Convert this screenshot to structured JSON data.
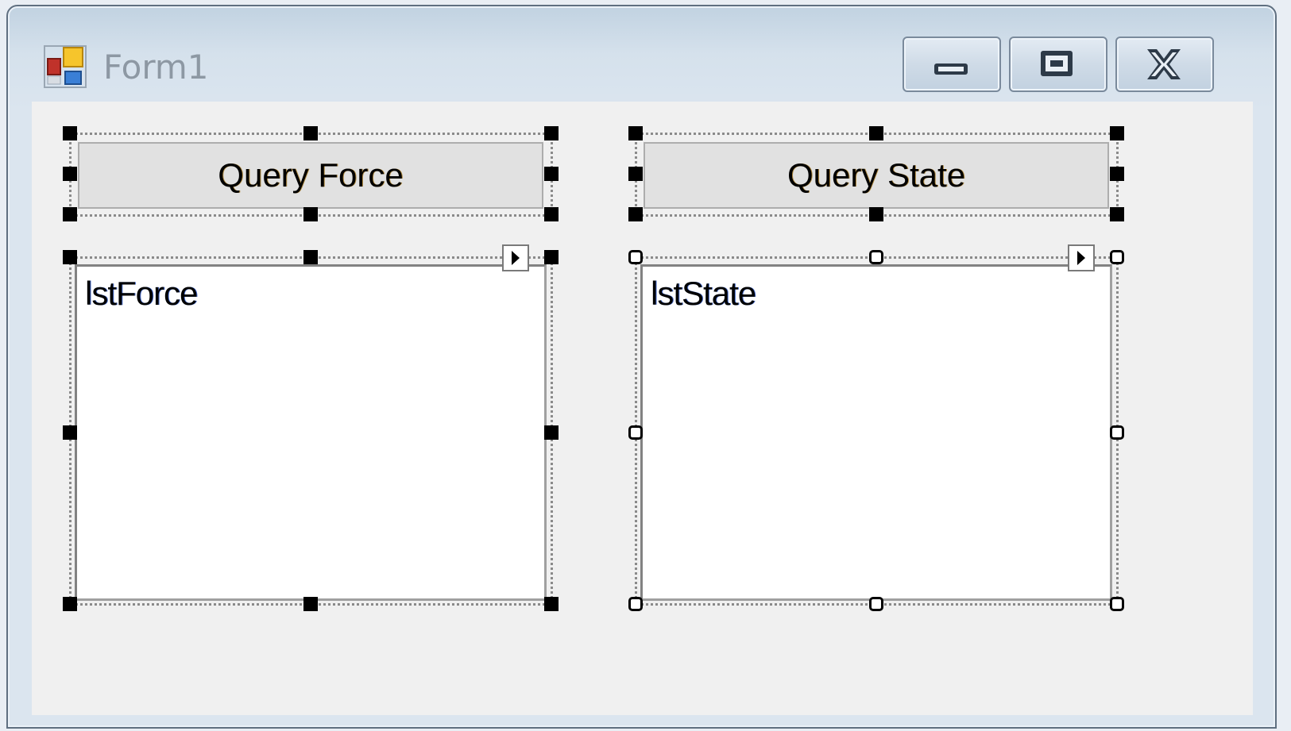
{
  "window": {
    "title": "Form1"
  },
  "caption_buttons": {
    "minimize_icon": "minimize-icon",
    "restore_icon": "restore-icon",
    "close_icon": "close-icon"
  },
  "controls": {
    "query_force_button": {
      "label": "Query Force"
    },
    "query_state_button": {
      "label": "Query State"
    },
    "force_listbox": {
      "name": "lstForce"
    },
    "state_listbox": {
      "name": "lstState"
    }
  },
  "colors": {
    "client_background": "#f0f0f0",
    "button_face": "#e1e1e1",
    "listbox_background": "#ffffff",
    "selection_handle": "#000000"
  }
}
